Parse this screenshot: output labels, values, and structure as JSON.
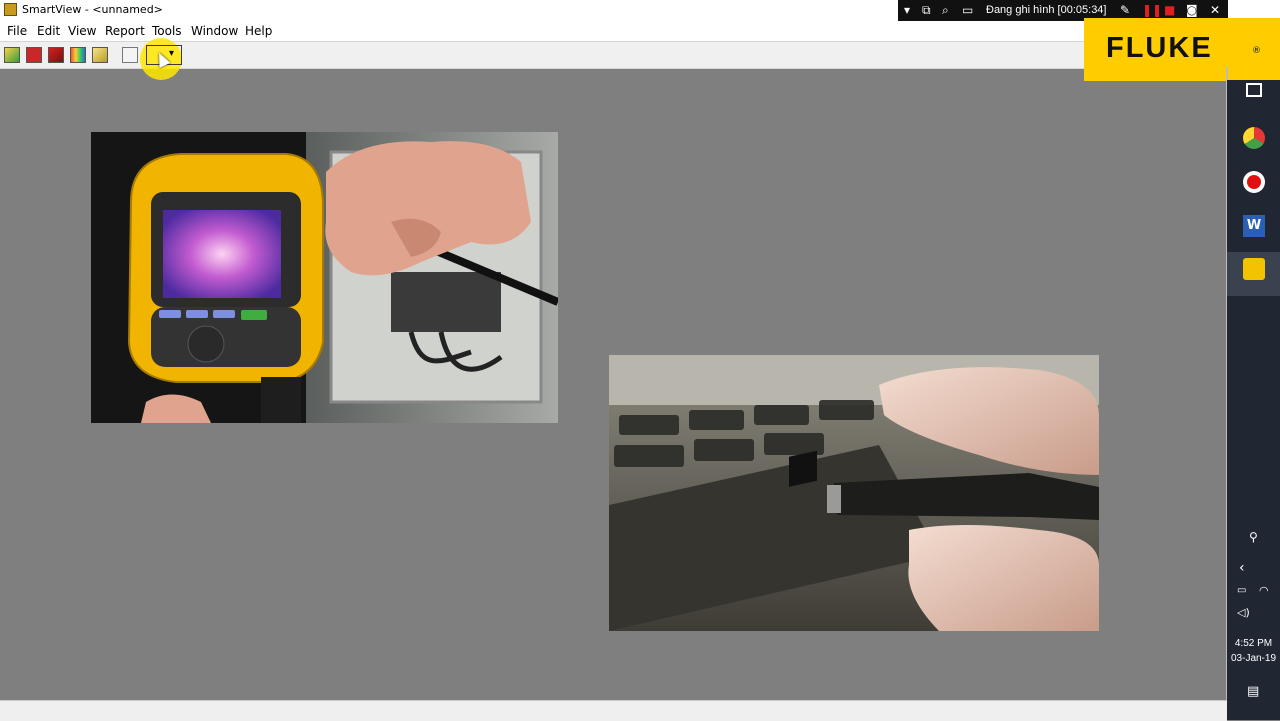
{
  "window": {
    "title": "SmartView - <unnamed>"
  },
  "menu": {
    "items": [
      "File",
      "Edit",
      "View",
      "Report",
      "Tools",
      "Window",
      "Help"
    ]
  },
  "toolbar": {
    "buttons": [
      "open-icon",
      "save-icon",
      "import-icon",
      "palette-icon",
      "edit-image-icon",
      "lock-icon",
      "tools-dropdown-icon"
    ]
  },
  "recorder": {
    "status": "Đang ghi hình [00:05:34]"
  },
  "brand": {
    "logo": "FLUKE",
    "registered": "®"
  },
  "images": [
    {
      "name": "thermal-camera-with-usb-cable"
    },
    {
      "name": "usb-plug-into-laptop"
    }
  ],
  "taskbar": {
    "time": "4:52 PM",
    "date": "03-Jan-19"
  },
  "colors": {
    "fluke_yellow": "#ffcc00",
    "canvas_gray": "#7f7f7f",
    "taskbar": "#202733"
  }
}
